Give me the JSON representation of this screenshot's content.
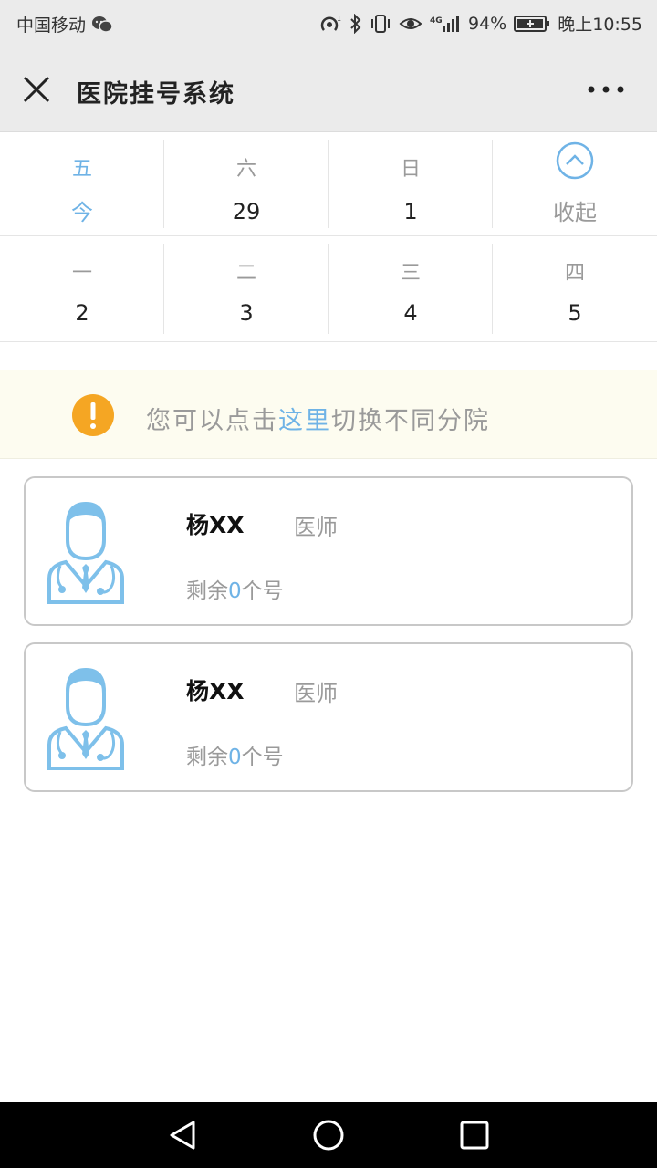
{
  "status_bar": {
    "carrier": "中国移动",
    "battery": "94%",
    "time": "晚上10:55",
    "network": "4G"
  },
  "header": {
    "title": "医院挂号系统"
  },
  "calendar": {
    "row1": [
      {
        "weekday": "五",
        "date": "今",
        "selected": true
      },
      {
        "weekday": "六",
        "date": "29"
      },
      {
        "weekday": "日",
        "date": "1"
      }
    ],
    "collapse_label": "收起",
    "row2": [
      {
        "weekday": "一",
        "date": "2"
      },
      {
        "weekday": "二",
        "date": "3"
      },
      {
        "weekday": "三",
        "date": "4"
      },
      {
        "weekday": "四",
        "date": "5"
      }
    ]
  },
  "notice": {
    "prefix": "您可以点击",
    "link": "这里",
    "suffix": "切换不同分院"
  },
  "doctors": [
    {
      "name": "杨XX",
      "title": "医师",
      "remain_prefix": "剩余",
      "remain_count": "0",
      "remain_suffix": "个号"
    },
    {
      "name": "杨XX",
      "title": "医师",
      "remain_prefix": "剩余",
      "remain_count": "0",
      "remain_suffix": "个号"
    }
  ],
  "colors": {
    "accent": "#6fb3e6",
    "warning": "#f5a623",
    "header_bg": "#ebebeb"
  }
}
